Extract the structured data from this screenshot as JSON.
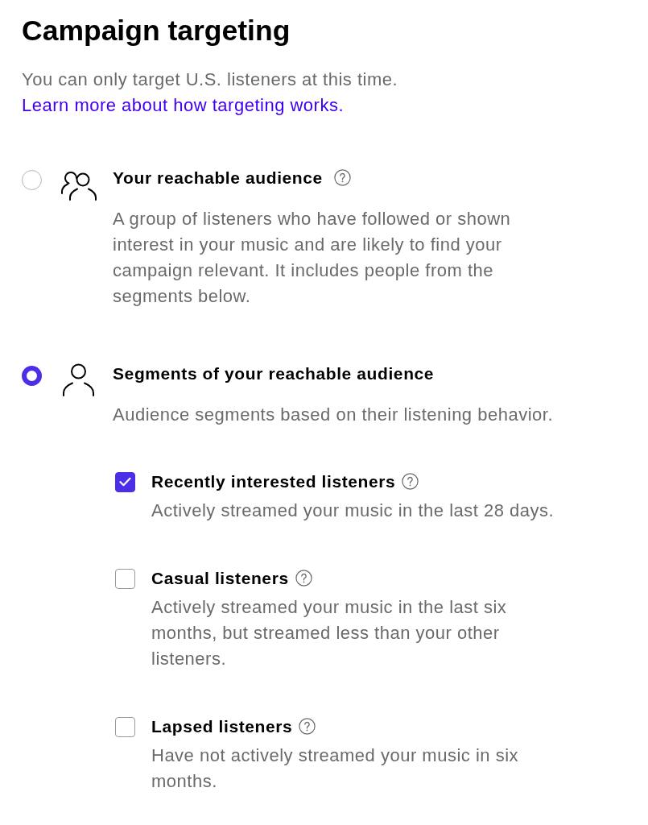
{
  "title": "Campaign targeting",
  "notice": {
    "text": "You can only target U.S. listeners at this time.",
    "link": "Learn more about how targeting works."
  },
  "options": [
    {
      "label": "Your reachable audience",
      "kind": "group",
      "help": true,
      "selected": false,
      "description": "A group of listeners who have followed or shown interest in your music and are likely to find your campaign relevant. It includes people from the segments below."
    },
    {
      "label": "Segments of your reachable audience",
      "kind": "single",
      "help": false,
      "selected": true,
      "description": "Audience segments based on their listening behavior.",
      "segments": [
        {
          "label": "Recently interested listeners",
          "help": true,
          "checked": true,
          "description": "Actively streamed your music in the last 28 days."
        },
        {
          "label": "Casual listeners",
          "help": true,
          "checked": false,
          "description": "Actively streamed your music in the last six months, but streamed less than your other listeners."
        },
        {
          "label": "Lapsed listeners",
          "help": true,
          "checked": false,
          "description": "Have not actively streamed your music in six months."
        }
      ]
    }
  ]
}
